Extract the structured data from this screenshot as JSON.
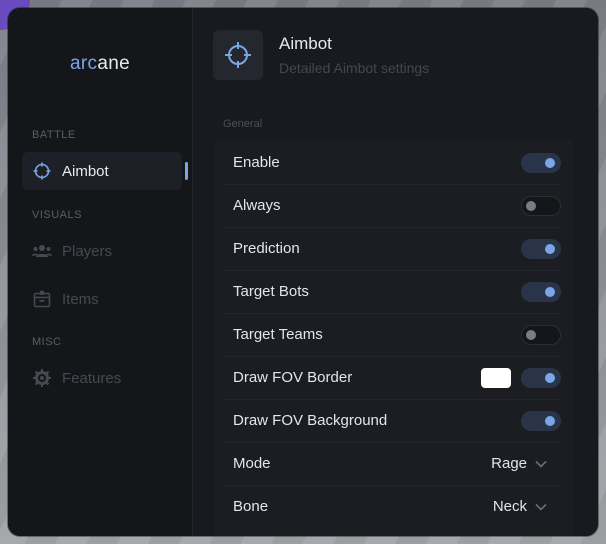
{
  "app": {
    "logo_part1": "arc",
    "logo_part2": "ane"
  },
  "sidebar": {
    "sections": [
      {
        "label": "BATTLE"
      },
      {
        "label": "VISUALS"
      },
      {
        "label": "MISC"
      }
    ],
    "items": [
      {
        "label": "Aimbot",
        "icon": "crosshair-icon",
        "active": true
      },
      {
        "label": "Players",
        "icon": "users-icon",
        "active": false
      },
      {
        "label": "Items",
        "icon": "box-icon",
        "active": false
      },
      {
        "label": "Features",
        "icon": "gear-icon",
        "active": false
      }
    ]
  },
  "header": {
    "title": "Aimbot",
    "subtitle": "Detailed Aimbot settings",
    "icon": "crosshair-icon"
  },
  "group": {
    "label": "General"
  },
  "settings": [
    {
      "label": "Enable",
      "type": "toggle",
      "on": true
    },
    {
      "label": "Always",
      "type": "toggle",
      "on": false
    },
    {
      "label": "Prediction",
      "type": "toggle",
      "on": true
    },
    {
      "label": "Target Bots",
      "type": "toggle",
      "on": true
    },
    {
      "label": "Target Teams",
      "type": "toggle",
      "on": false
    },
    {
      "label": "Draw FOV Border",
      "type": "toggle-color",
      "on": true,
      "color": "#ffffff"
    },
    {
      "label": "Draw FOV Background",
      "type": "toggle",
      "on": true
    },
    {
      "label": "Mode",
      "type": "select",
      "value": "Rage"
    },
    {
      "label": "Bone",
      "type": "select",
      "value": "Neck"
    }
  ],
  "colors": {
    "accent": "#7aa6e8",
    "background": "#17181c",
    "toggle_on_track": "#2a3448"
  }
}
